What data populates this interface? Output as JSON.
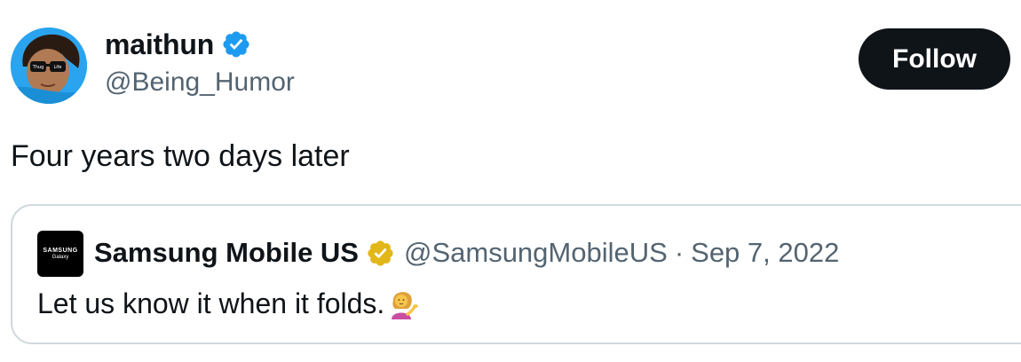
{
  "author": {
    "display_name": "maithun",
    "handle": "@Being_Humor",
    "verified_icon": "verified-blue-badge-icon",
    "avatar": "user-avatar-sunglasses"
  },
  "follow_button": {
    "label": "Follow"
  },
  "tweet": {
    "text": "Four years two days later"
  },
  "quoted_tweet": {
    "avatar_brand": "SAMSUNG",
    "avatar_sub": "Galaxy",
    "display_name": "Samsung Mobile US",
    "verified_icon": "verified-gold-badge-icon",
    "handle": "@SamsungMobileUS",
    "separator": "·",
    "date": "Sep 7, 2022",
    "text": "Let us know it when it folds.",
    "emoji": "woman-tipping-hand-emoji"
  },
  "colors": {
    "verified_blue": "#1d9bf0",
    "verified_gold": "#e2b719",
    "follow_bg": "#0f1419",
    "secondary_text": "#536471",
    "border": "#cfd9de"
  }
}
